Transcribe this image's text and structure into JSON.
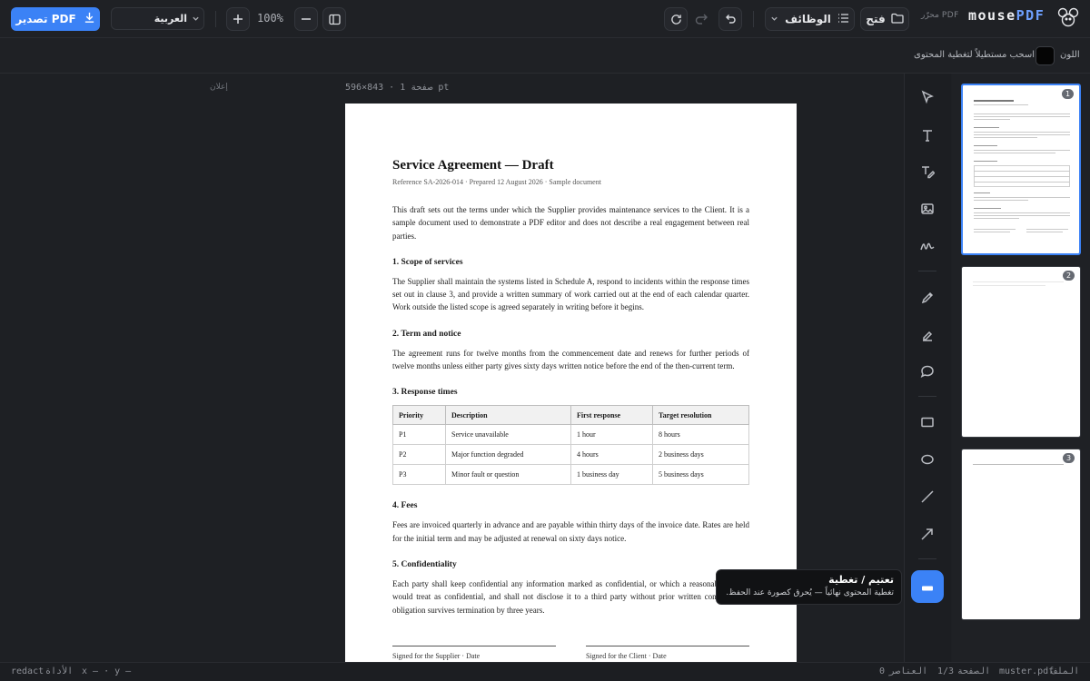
{
  "toolbar": {
    "export_label": "تصدير PDF",
    "language": "العربية",
    "zoom": "100%",
    "functions_label": "الوظائف",
    "open_label": "فتح",
    "editor_label": "محرّر PDF",
    "brand_name": "mouse",
    "brand_suffix": "PDF"
  },
  "options": {
    "color_label": "اللون",
    "color_value": "#050505",
    "hint": "اسحب مستطيلاً لتغطية المحتوى"
  },
  "canvas": {
    "ad_label": "إعلان",
    "page_info": "صفحة 1 · 843×596 pt"
  },
  "document": {
    "title": "Service Agreement — Draft",
    "reference": "Reference SA-2026-014 · Prepared 12 August 2026 · Sample document",
    "intro": "This draft sets out the terms under which the Supplier provides maintenance services to the Client. It is a sample document used to demonstrate a PDF editor and does not describe a real engagement between real parties.",
    "sections": [
      {
        "heading": "1. Scope of services",
        "body": "The Supplier shall maintain the systems listed in Schedule A, respond to incidents within the response times set out in clause 3, and provide a written summary of work carried out at the end of each calendar quarter. Work outside the listed scope is agreed separately in writing before it begins."
      },
      {
        "heading": "2. Term and notice",
        "body": "The agreement runs for twelve months from the commencement date and renews for further periods of twelve months unless either party gives sixty days written notice before the end of the then-current term."
      },
      {
        "heading": "3. Response times",
        "body": ""
      },
      {
        "heading": "4. Fees",
        "body": "Fees are invoiced quarterly in advance and are payable within thirty days of the invoice date. Rates are held for the initial term and may be adjusted at renewal on sixty days notice."
      },
      {
        "heading": "5. Confidentiality",
        "body": "Each party shall keep confidential any information marked as confidential, or which a reasonable person would treat as confidential, and shall not disclose it to a third party without prior written consent. This obligation survives termination by three years."
      }
    ],
    "table": {
      "headers": [
        "Priority",
        "Description",
        "First response",
        "Target resolution"
      ],
      "rows": [
        [
          "P1",
          "Service unavailable",
          "1 hour",
          "8 hours"
        ],
        [
          "P2",
          "Major function degraded",
          "4 hours",
          "2 business days"
        ],
        [
          "P3",
          "Minor fault or question",
          "1 business day",
          "5 business days"
        ]
      ]
    },
    "signature_supplier": "Signed for the Supplier · Date",
    "signature_client": "Signed for the Client · Date"
  },
  "tools": [
    "select-icon",
    "text-icon",
    "edit-text-icon",
    "image-icon",
    "signature-icon",
    "pen-icon",
    "highlighter-icon",
    "comment-icon",
    "rectangle-icon",
    "ellipse-icon",
    "line-icon",
    "arrow-icon",
    "redact-icon"
  ],
  "tooltip": {
    "title": "تعتيم / تغطية",
    "desc": "تغطية المحتوى نهائياً — يُحرق كصورة عند الحفظ."
  },
  "thumbnails": [
    {
      "num": "1"
    },
    {
      "num": "2"
    },
    {
      "num": "3"
    }
  ],
  "status": {
    "tool_label": "الأداة",
    "tool_value": "redact",
    "coords": "x — · y —",
    "elements_label": "العناصر",
    "elements_value": "0",
    "page_label": "الصفحة",
    "page_value": "1/3",
    "file_label": "الملف",
    "file_value": "muster.pdf"
  }
}
